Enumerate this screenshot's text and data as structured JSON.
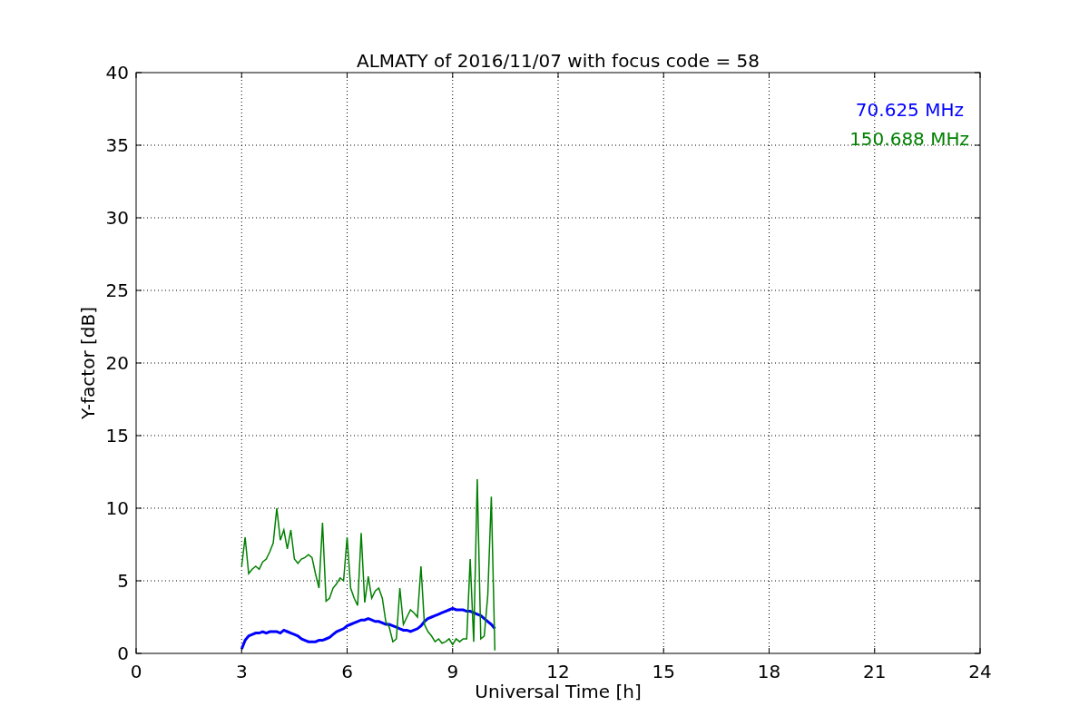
{
  "figure": {
    "chart_data": {
      "type": "line",
      "title": "ALMATY of 2016/11/07 with focus code = 58",
      "xlabel": "Universal Time [h]",
      "ylabel": "Y-factor [dB]",
      "x": [
        3.0,
        3.1,
        3.2,
        3.3,
        3.4,
        3.5,
        3.6,
        3.7,
        3.8,
        3.9,
        4.0,
        4.1,
        4.2,
        4.3,
        4.4,
        4.5,
        4.6,
        4.7,
        4.8,
        4.9,
        5.0,
        5.1,
        5.2,
        5.3,
        5.4,
        5.5,
        5.6,
        5.7,
        5.8,
        5.9,
        6.0,
        6.1,
        6.2,
        6.3,
        6.4,
        6.5,
        6.6,
        6.7,
        6.8,
        6.9,
        7.0,
        7.1,
        7.2,
        7.3,
        7.4,
        7.5,
        7.6,
        7.7,
        7.8,
        7.9,
        8.0,
        8.1,
        8.2,
        8.3,
        8.4,
        8.5,
        8.6,
        8.7,
        8.8,
        8.9,
        9.0,
        9.1,
        9.2,
        9.3,
        9.4,
        9.5,
        9.6,
        9.7,
        9.8,
        9.9,
        10.0,
        10.1,
        10.2
      ],
      "series": [
        {
          "name": "70.625 MHz",
          "color": "#0000ff",
          "values": [
            0.3,
            0.9,
            1.2,
            1.3,
            1.4,
            1.4,
            1.5,
            1.4,
            1.5,
            1.5,
            1.5,
            1.4,
            1.6,
            1.5,
            1.4,
            1.3,
            1.2,
            1.0,
            0.9,
            0.8,
            0.8,
            0.8,
            0.9,
            0.9,
            1.0,
            1.1,
            1.3,
            1.5,
            1.6,
            1.7,
            1.9,
            2.0,
            2.1,
            2.2,
            2.3,
            2.3,
            2.4,
            2.3,
            2.2,
            2.2,
            2.1,
            2.0,
            2.0,
            1.9,
            1.8,
            1.7,
            1.6,
            1.6,
            1.5,
            1.6,
            1.7,
            1.9,
            2.2,
            2.4,
            2.5,
            2.6,
            2.7,
            2.8,
            2.9,
            3.0,
            3.1,
            3.0,
            3.0,
            3.0,
            2.9,
            2.9,
            2.8,
            2.7,
            2.6,
            2.4,
            2.2,
            2.0,
            1.7
          ]
        },
        {
          "name": "150.688 MHz",
          "color": "#008000",
          "values": [
            6.0,
            8.0,
            5.5,
            5.8,
            6.0,
            5.8,
            6.3,
            6.5,
            7.0,
            7.6,
            10.0,
            7.8,
            8.5,
            7.2,
            8.5,
            6.5,
            6.2,
            6.5,
            6.6,
            6.8,
            6.6,
            5.5,
            4.5,
            9.0,
            3.6,
            3.8,
            4.5,
            4.8,
            5.2,
            5.0,
            8.0,
            4.5,
            3.8,
            3.3,
            8.3,
            3.5,
            5.3,
            3.8,
            4.3,
            4.5,
            3.8,
            2.2,
            1.8,
            0.8,
            1.0,
            4.5,
            2.0,
            2.5,
            3.0,
            2.8,
            2.5,
            6.0,
            2.0,
            1.5,
            1.2,
            0.8,
            1.0,
            0.7,
            0.8,
            1.0,
            0.6,
            1.0,
            0.8,
            1.0,
            1.0,
            6.5,
            0.8,
            12.0,
            1.0,
            1.2,
            4.0,
            10.8,
            0.2
          ]
        }
      ],
      "grid": true,
      "xlim": [
        0,
        24
      ],
      "ylim": [
        0,
        40
      ],
      "xticks": [
        0,
        3,
        6,
        9,
        12,
        15,
        18,
        21,
        24
      ],
      "yticks": [
        0,
        5,
        10,
        15,
        20,
        25,
        30,
        35,
        40
      ]
    }
  }
}
